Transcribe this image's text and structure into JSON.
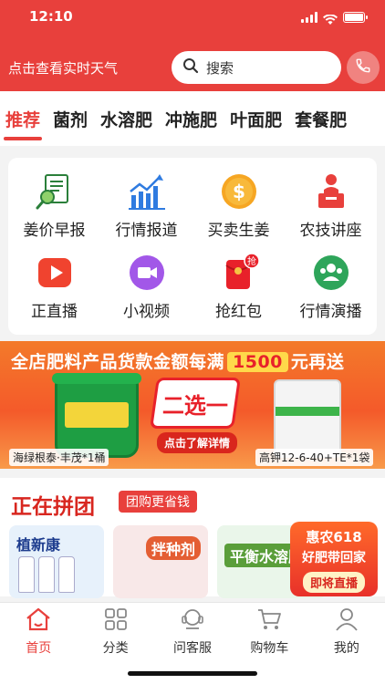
{
  "status": {
    "time": "12:10"
  },
  "header": {
    "weather_text": "点击查看实时天气",
    "search_placeholder": "搜索",
    "phone_icon": "phone-icon"
  },
  "tabs": [
    {
      "label": "推荐",
      "active": true
    },
    {
      "label": "菌剂"
    },
    {
      "label": "水溶肥"
    },
    {
      "label": "冲施肥"
    },
    {
      "label": "叶面肥"
    },
    {
      "label": "套餐肥"
    }
  ],
  "grid": [
    {
      "label": "姜价早报",
      "icon": "report-icon"
    },
    {
      "label": "行情报道",
      "icon": "chart-icon"
    },
    {
      "label": "买卖生姜",
      "icon": "dollar-icon"
    },
    {
      "label": "农技讲座",
      "icon": "lecture-icon"
    },
    {
      "label": "正直播",
      "icon": "play-icon"
    },
    {
      "label": "小视频",
      "icon": "video-icon"
    },
    {
      "label": "抢红包",
      "icon": "red-envelope-icon",
      "badge": "抢"
    },
    {
      "label": "行情演播",
      "icon": "group-icon"
    }
  ],
  "banner": {
    "headline_prefix": "全店肥料产品货款金额每满",
    "headline_amount": "1500",
    "headline_suffix": "元再送",
    "choose": "二选一",
    "detail_button": "点击了解详情",
    "left_caption": "海绿根泰·丰茂*1桶",
    "right_caption": "高钾12-6-40+TE*1袋"
  },
  "group_buy": {
    "title": "正在拼团",
    "tag": "团购更省钱",
    "products": [
      {
        "name": "植新康"
      },
      {
        "name": "拌种剂"
      },
      {
        "name": "平衡水溶肥"
      }
    ],
    "promo": {
      "line1": "惠农618",
      "line2": "好肥带回家",
      "button": "即将直播"
    }
  },
  "bottom_nav": [
    {
      "label": "首页",
      "icon": "home-icon",
      "active": true
    },
    {
      "label": "分类",
      "icon": "category-icon"
    },
    {
      "label": "问客服",
      "icon": "customer-service-icon"
    },
    {
      "label": "购物车",
      "icon": "cart-icon"
    },
    {
      "label": "我的",
      "icon": "profile-icon"
    }
  ],
  "colors": {
    "brand": "#e8403c",
    "text": "#222222"
  }
}
